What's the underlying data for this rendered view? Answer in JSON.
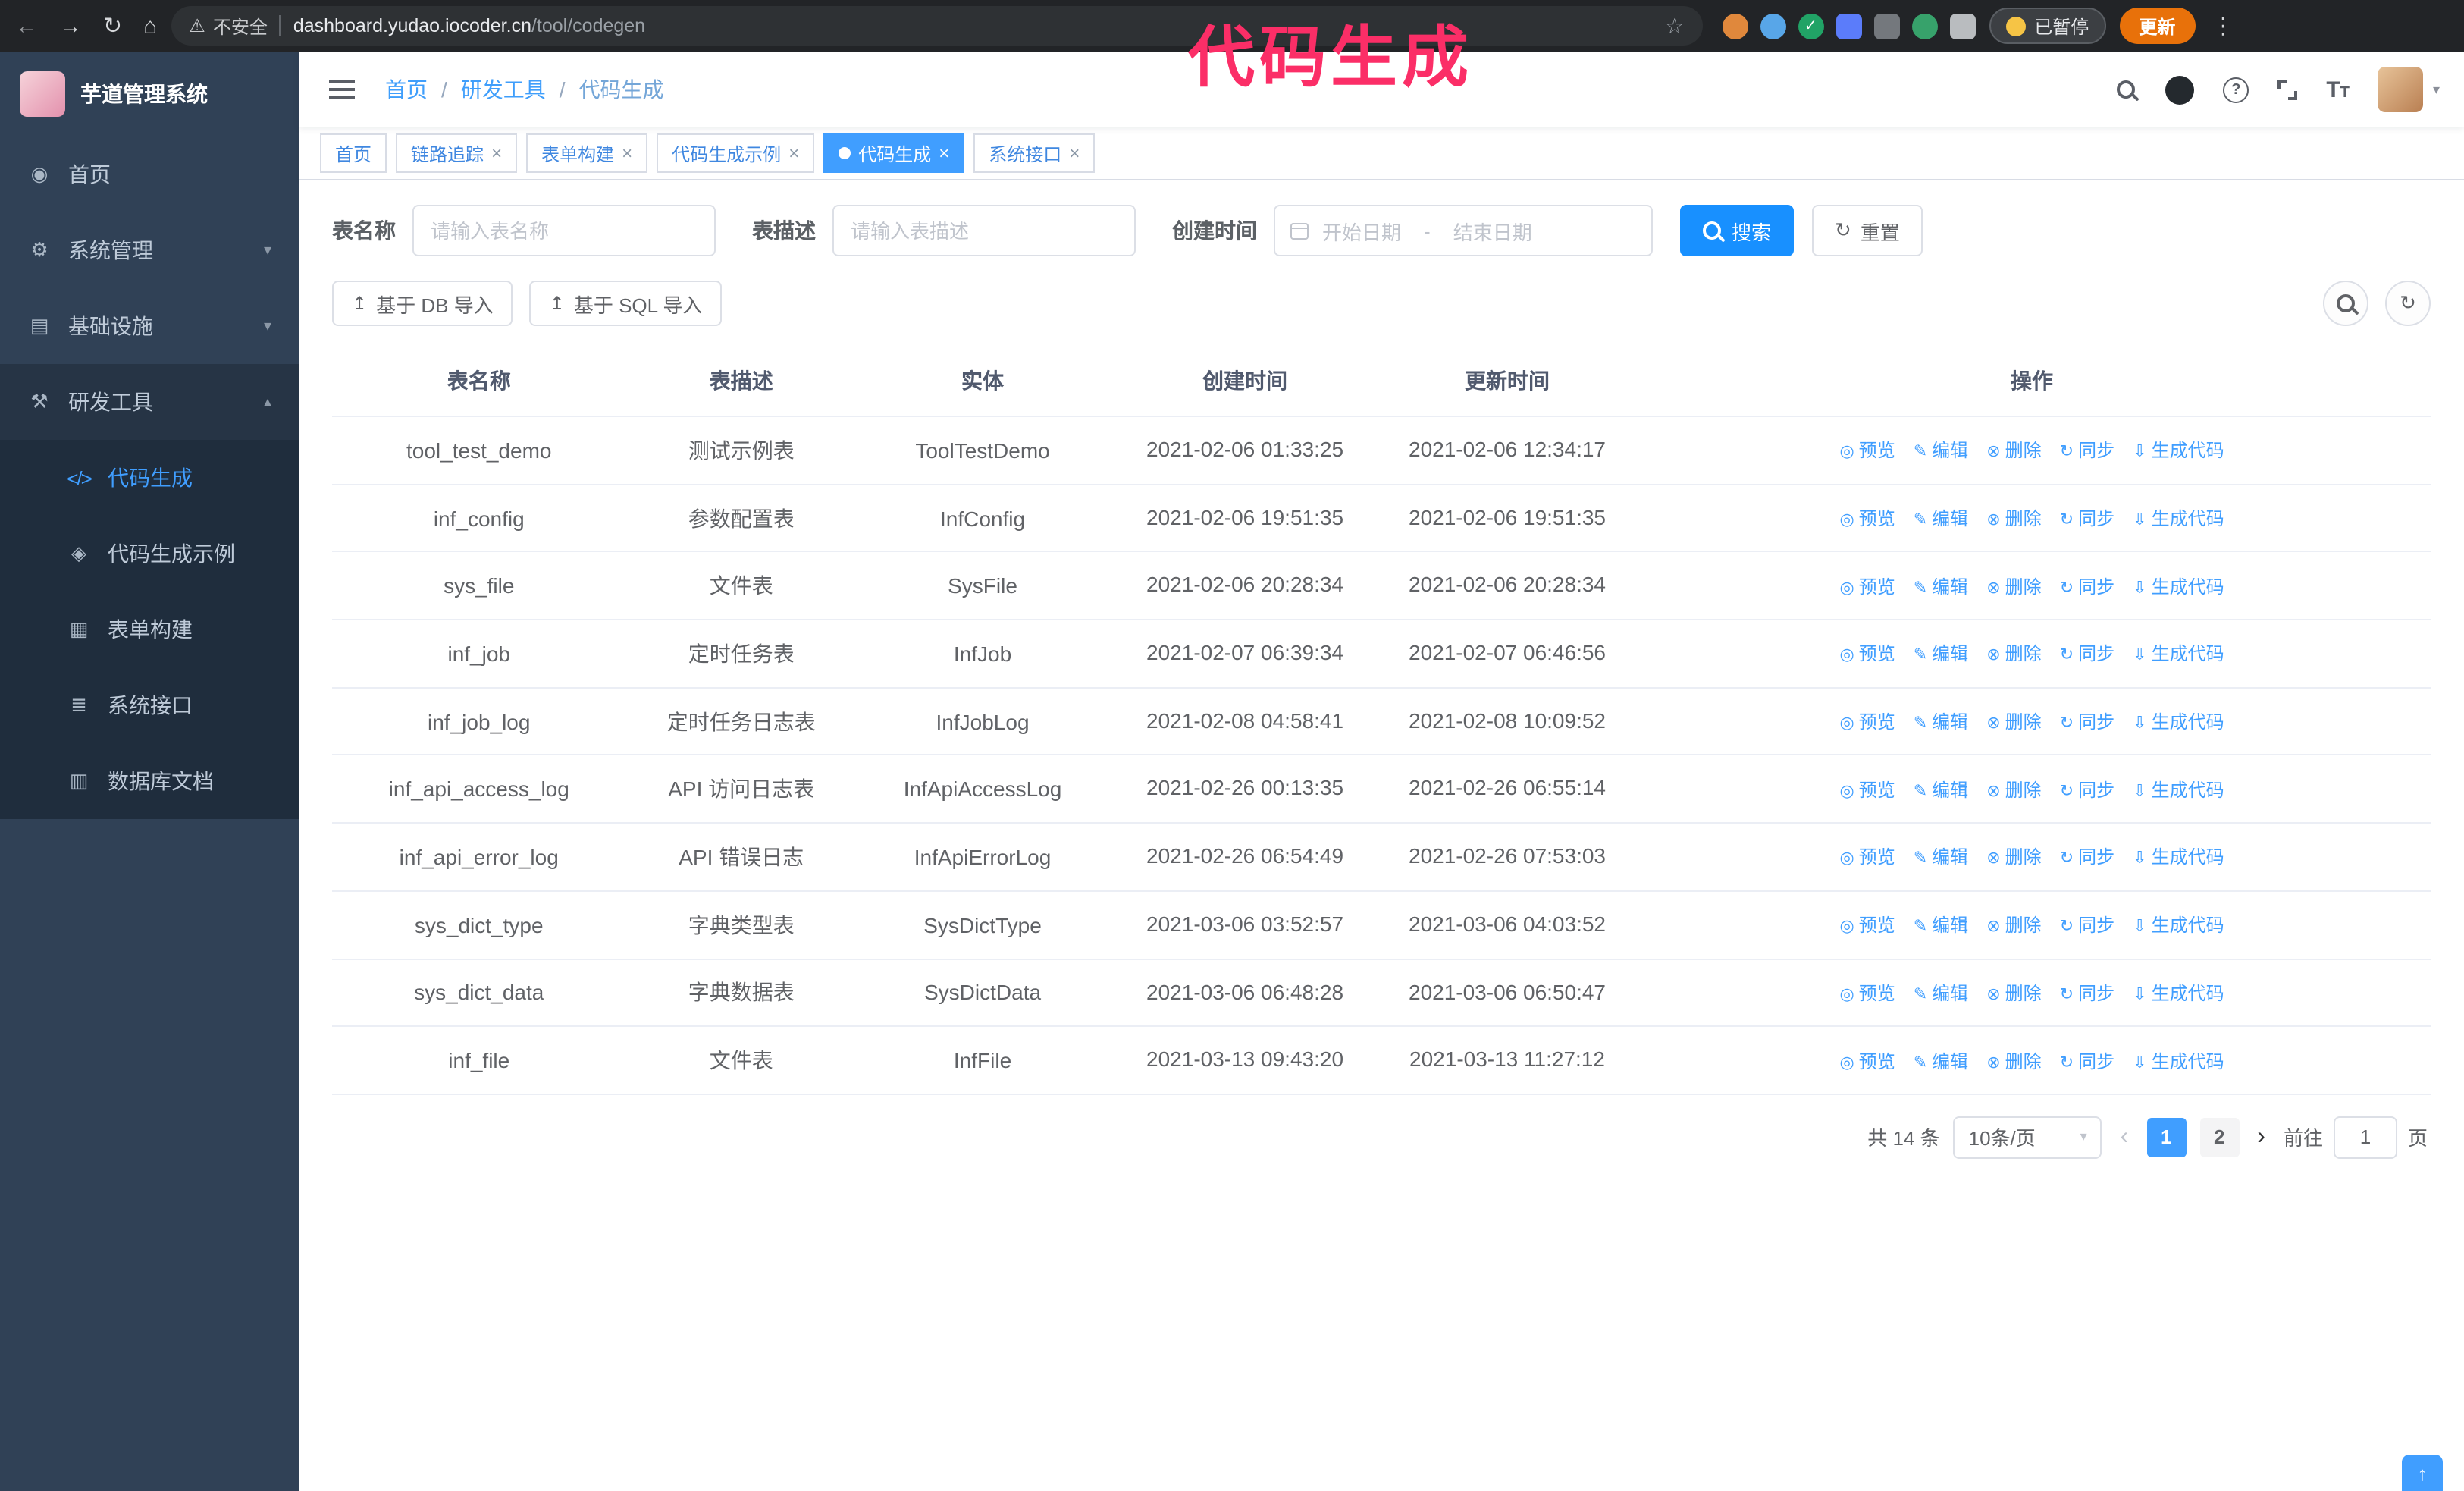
{
  "annotation": {
    "text": "代码生成",
    "color": "#fb2e67"
  },
  "browser": {
    "security_label": "不安全",
    "url_host": "dashboard.yudao.iocoder.cn",
    "url_path": "/tool/codegen",
    "paused_badge": "已暂停",
    "update_button": "更新",
    "extensions": [
      {
        "name": "orange-extension-icon",
        "color": "#e0883c",
        "shape": "circle"
      },
      {
        "name": "blue-drop-extension-icon",
        "color": "#58a6e8",
        "shape": "circle"
      },
      {
        "name": "green-check-extension-icon",
        "color": "#21a366",
        "shape": "circle",
        "glyph": "✓"
      },
      {
        "name": "people-grid-extension-icon",
        "color": "#5b7cfa",
        "shape": "square"
      },
      {
        "name": "gray-extension-icon",
        "color": "#74787d",
        "shape": "square"
      },
      {
        "name": "green-leaf-extension-icon",
        "color": "#37a26b",
        "shape": "circle"
      },
      {
        "name": "puzzle-extensions-icon",
        "color": "#b9bcbf",
        "shape": "square"
      }
    ]
  },
  "icons": {
    "back": "←",
    "forward": "→",
    "reload": "↻",
    "home": "⌂",
    "warning": "⚠",
    "star": "☆",
    "menu_dots": "⋮",
    "close": "×",
    "caret_down": "▾",
    "caret_up": "▴",
    "dashboard": "◉",
    "gear": "⚙",
    "infra": "▤",
    "tools": "⚒",
    "code": "</>",
    "example": "◈",
    "form": "▦",
    "api": "≣",
    "db": "▥",
    "reset": "↻",
    "upload": "↥",
    "refresh": "↻",
    "help": "?",
    "top": "↑",
    "prev": "‹",
    "next": "›"
  },
  "sidebar": {
    "logo_title": "芋道管理系统",
    "items": [
      {
        "label": "首页"
      },
      {
        "label": "系统管理"
      },
      {
        "label": "基础设施"
      },
      {
        "label": "研发工具"
      }
    ],
    "subitems": [
      {
        "label": "代码生成"
      },
      {
        "label": "代码生成示例"
      },
      {
        "label": "表单构建"
      },
      {
        "label": "系统接口"
      },
      {
        "label": "数据库文档"
      }
    ]
  },
  "header": {
    "breadcrumb": [
      "首页",
      "研发工具",
      "代码生成"
    ],
    "breadcrumb_separator": "/"
  },
  "tabs": [
    {
      "label": "首页"
    },
    {
      "label": "链路追踪"
    },
    {
      "label": "表单构建"
    },
    {
      "label": "代码生成示例"
    },
    {
      "label": "代码生成"
    },
    {
      "label": "系统接口"
    }
  ],
  "filters": {
    "table_name_label": "表名称",
    "table_name_placeholder": "请输入表名称",
    "table_desc_label": "表描述",
    "table_desc_placeholder": "请输入表描述",
    "create_time_label": "创建时间",
    "date_start_placeholder": "开始日期",
    "date_separator": "-",
    "date_end_placeholder": "结束日期",
    "search_button": "搜索",
    "reset_button": "重置"
  },
  "toolbar": {
    "import_db": "基于 DB 导入",
    "import_sql": "基于 SQL 导入"
  },
  "table": {
    "columns": [
      "表名称",
      "表描述",
      "实体",
      "创建时间",
      "更新时间",
      "操作"
    ],
    "actions": [
      {
        "label": "预览",
        "icon": "◎",
        "name": "action-preview",
        "icon_name": "eye-icon"
      },
      {
        "label": "编辑",
        "icon": "✎",
        "name": "action-edit",
        "icon_name": "edit-icon"
      },
      {
        "label": "删除",
        "icon": "⊗",
        "name": "action-delete",
        "icon_name": "delete-icon"
      },
      {
        "label": "同步",
        "icon": "↻",
        "name": "action-sync",
        "icon_name": "sync-icon"
      },
      {
        "label": "生成代码",
        "icon": "⇩",
        "name": "action-generate-code",
        "icon_name": "download-icon"
      }
    ],
    "rows": [
      {
        "name": "tool_test_demo",
        "desc": "测试示例表",
        "entity": "ToolTestDemo",
        "created": "2021-02-06 01:33:25",
        "updated": "2021-02-06 12:34:17"
      },
      {
        "name": "inf_config",
        "desc": "参数配置表",
        "entity": "InfConfig",
        "created": "2021-02-06 19:51:35",
        "updated": "2021-02-06 19:51:35"
      },
      {
        "name": "sys_file",
        "desc": "文件表",
        "entity": "SysFile",
        "created": "2021-02-06 20:28:34",
        "updated": "2021-02-06 20:28:34"
      },
      {
        "name": "inf_job",
        "desc": "定时任务表",
        "entity": "InfJob",
        "created": "2021-02-07 06:39:34",
        "updated": "2021-02-07 06:46:56"
      },
      {
        "name": "inf_job_log",
        "desc": "定时任务日志表",
        "entity": "InfJobLog",
        "created": "2021-02-08 04:58:41",
        "updated": "2021-02-08 10:09:52"
      },
      {
        "name": "inf_api_access_log",
        "desc": "API 访问日志表",
        "entity": "InfApiAccessLog",
        "created": "2021-02-26 00:13:35",
        "updated": "2021-02-26 06:55:14"
      },
      {
        "name": "inf_api_error_log",
        "desc": "API 错误日志",
        "entity": "InfApiErrorLog",
        "created": "2021-02-26 06:54:49",
        "updated": "2021-02-26 07:53:03"
      },
      {
        "name": "sys_dict_type",
        "desc": "字典类型表",
        "entity": "SysDictType",
        "created": "2021-03-06 03:52:57",
        "updated": "2021-03-06 04:03:52"
      },
      {
        "name": "sys_dict_data",
        "desc": "字典数据表",
        "entity": "SysDictData",
        "created": "2021-03-06 06:48:28",
        "updated": "2021-03-06 06:50:47"
      },
      {
        "name": "inf_file",
        "desc": "文件表",
        "entity": "InfFile",
        "created": "2021-03-13 09:43:20",
        "updated": "2021-03-13 11:27:12"
      }
    ]
  },
  "pagination": {
    "total": "共 14 条",
    "page_size": "10条/页",
    "pages": [
      "1",
      "2"
    ],
    "goto_label": "前往",
    "goto_value": "1",
    "goto_suffix": "页"
  }
}
